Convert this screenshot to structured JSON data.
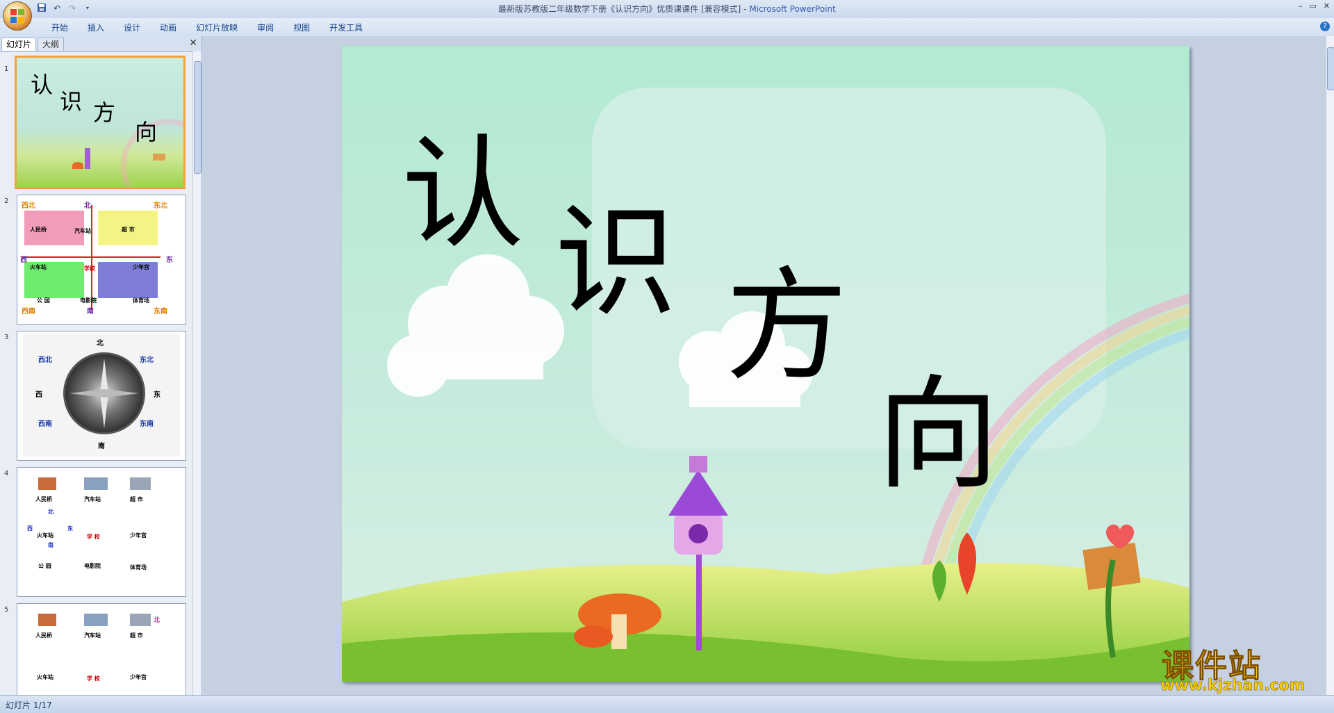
{
  "window": {
    "title_doc": "最新版苏教版二年级数学下册《认识方向》优质课课件 [兼容模式]",
    "title_sep": " - ",
    "title_app": "Microsoft PowerPoint",
    "controls": [
      "–",
      "▭",
      "✕"
    ]
  },
  "ribbon": {
    "tabs": [
      "开始",
      "插入",
      "设计",
      "动画",
      "幻灯片放映",
      "审阅",
      "视图",
      "开发工具"
    ],
    "help": "?"
  },
  "pane": {
    "tab_slides": "幻灯片",
    "tab_outline": "大纲",
    "close": "✕",
    "thumb_numbers": [
      "1",
      "2",
      "3",
      "4",
      "5"
    ]
  },
  "slide1_thumb": {
    "chars": [
      "认",
      "识",
      "方",
      "向"
    ]
  },
  "slide2_thumb": {
    "labels": [
      "西北",
      "北",
      "东北",
      "西",
      "东",
      "西南",
      "南",
      "东南",
      "人民桥",
      "汽车站",
      "超 市",
      "火车站",
      "少年宫",
      "公 园",
      "电影院",
      "体育场",
      "学校"
    ]
  },
  "slide3_thumb": {
    "labels": [
      "北",
      "西北",
      "东北",
      "西",
      "东",
      "西南",
      "东南",
      "南"
    ]
  },
  "slide4_thumb": {
    "labels": [
      "人民桥",
      "汽车站",
      "超 市",
      "北",
      "西",
      "东",
      "南",
      "火车站",
      "学 校",
      "少年宫",
      "公 园",
      "电影院",
      "体育场"
    ]
  },
  "slide5_thumb": {
    "labels": [
      "人民桥",
      "汽车站",
      "超 市",
      "北",
      "火车站",
      "学 校",
      "少年宫"
    ]
  },
  "main_slide": {
    "title_chars": [
      "认",
      "识",
      "方",
      "向"
    ]
  },
  "watermark": {
    "line1": "课件站",
    "line2": "www.kjzhan.com"
  },
  "status": {
    "slide_indicator": "幻灯片 1/17"
  },
  "colors": {
    "accent_selected": "#f0a33a",
    "ribbon_text": "#15428b"
  }
}
